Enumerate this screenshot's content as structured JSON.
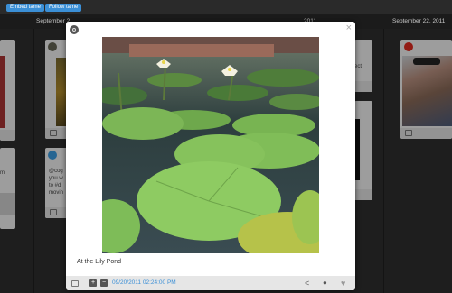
{
  "topbar": {
    "embed_label": "Embed tame",
    "follow_label": "Follow tame"
  },
  "timeline": {
    "date_left": "September 2",
    "date_mid": "2011",
    "date_right": "September 22, 2011"
  },
  "cards": {
    "twitter_lines": [
      "@cog",
      "you w",
      "to #d",
      "movin"
    ],
    "right_partial": "ect"
  },
  "modal": {
    "caption": "At the Lily Pond",
    "timestamp": "09/20/2011 02:24:00 PM"
  },
  "colors": {
    "accent": "#3b8fd6",
    "background": "#2f2f2f"
  }
}
